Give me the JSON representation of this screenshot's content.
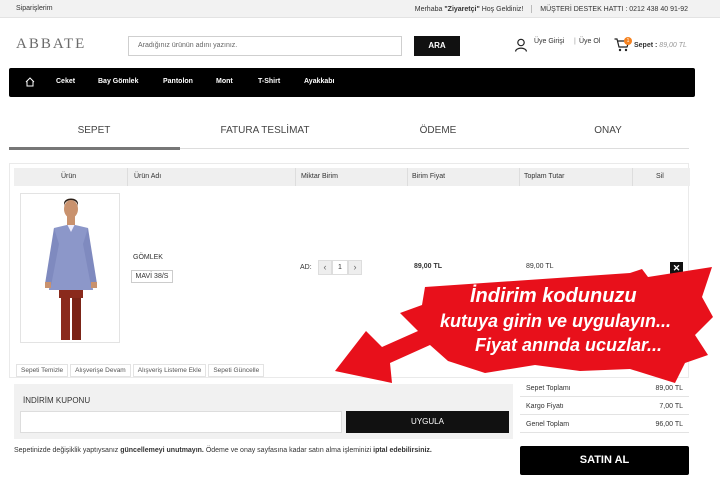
{
  "topbar": {
    "orders_link": "Siparişlerim",
    "greeting_prefix": "Merhaba",
    "greeting_name": "\"Ziyaretçi\"",
    "greeting_suffix": "Hoş Geldiniz!",
    "hotline": "MÜŞTERİ DESTEK HATTI : 0212 438 40 91-92"
  },
  "header": {
    "logo": "ABBATE",
    "search_placeholder": "Aradığınız ürünün adını yazınız.",
    "search_button": "ARA",
    "login": "Üye Girişi",
    "register": "Üye Ol",
    "cart_label": "Sepet :",
    "cart_total": "89,00 TL",
    "cart_count": "1"
  },
  "nav": {
    "items": [
      "Ceket",
      "Bay Gömlek",
      "Pantolon",
      "Mont",
      "T-Shirt",
      "Ayakkabı"
    ]
  },
  "steps": [
    "SEPET",
    "FATURA TESLİMAT",
    "ÖDEME",
    "ONAY"
  ],
  "table": {
    "headers": [
      "Ürün",
      "Ürün Adı",
      "Miktar Birim",
      "Birim Fiyat",
      "Toplam Tutar",
      "Sil"
    ],
    "row": {
      "name": "GÖMLEK",
      "variant": "MAVİ 38/S",
      "unit": "AD:",
      "qty": "1",
      "unit_price": "89,00 TL",
      "total": "89,00 TL"
    }
  },
  "actions": [
    "Sepeti Temizle",
    "Alışverişe Devam",
    "Alışveriş Listeme Ekle",
    "Sepeti Güncelle"
  ],
  "coupon": {
    "title": "İNDİRİM KUPONU",
    "button": "UYGULA"
  },
  "summary": [
    {
      "label": "Sepet Toplamı",
      "value": "89,00 TL"
    },
    {
      "label": "Kargo Fiyatı",
      "value": "7,00 TL"
    },
    {
      "label": "Genel Toplam",
      "value": "96,00 TL"
    }
  ],
  "note": {
    "part1": "Sepetinizde değişiklik yaptıysanız ",
    "bold1": "güncellemeyi unutmayın.",
    "part2": " Ödeme ve onay sayfasına kadar satın alma işleminizi ",
    "bold2": "iptal edebilirsiniz."
  },
  "buy_button": "SATIN AL",
  "promo": {
    "line1": "İndirim kodunuzu",
    "line2": "kutuya girin ve uygulayın...",
    "line3": "Fiyat anında ucuzlar..."
  },
  "colors": {
    "accent": "#f58220",
    "promo_red": "#e8101b"
  }
}
